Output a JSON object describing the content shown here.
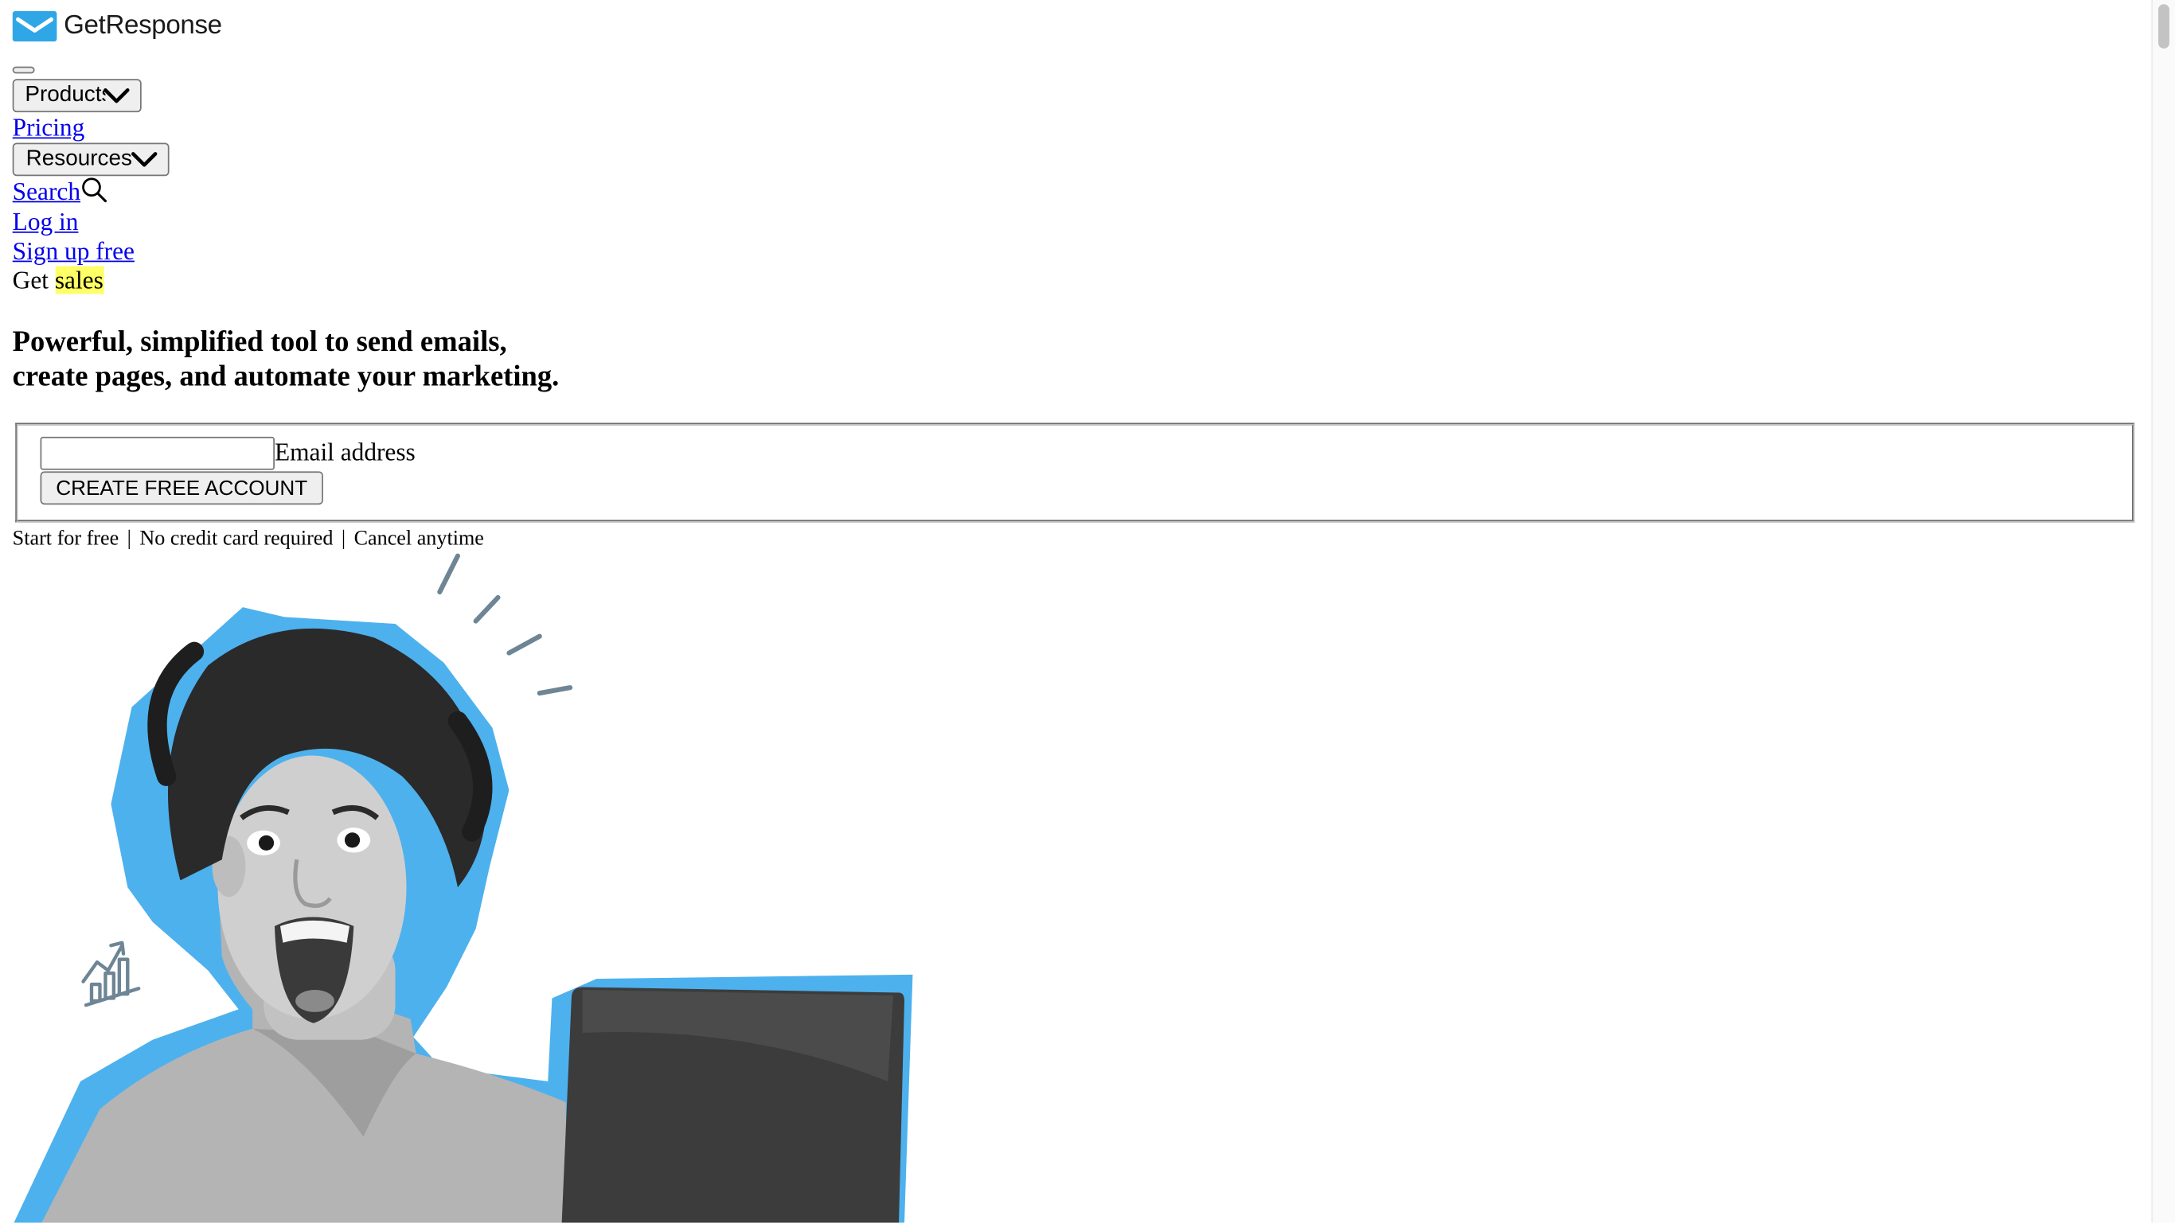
{
  "brand": {
    "name": "GetResponse",
    "logo_color": "#2fa6e6"
  },
  "nav": {
    "menu_toggle": "",
    "products_label": "Products",
    "pricing_label": "Pricing",
    "resources_label": "Resources",
    "search_label": "Search",
    "login_label": "Log in",
    "signup_label": "Sign up free"
  },
  "hero": {
    "get_text": "Get",
    "highlight_word": "sales",
    "highlight_color": "#ffff66",
    "headline_line1": "Powerful, simplified tool to send emails,",
    "headline_line2": "create pages, and automate your marketing."
  },
  "form": {
    "email_value": "",
    "email_label": "Email address",
    "submit_label": "CREATE FREE ACCOUNT"
  },
  "tagline": {
    "part1": "Start for free",
    "part2": "No credit card required",
    "part3": "Cancel anytime",
    "separator": "|"
  },
  "colors": {
    "accent_blue": "#4db1ee",
    "link": "#0000ee",
    "doodle_gray": "#6e8595"
  }
}
